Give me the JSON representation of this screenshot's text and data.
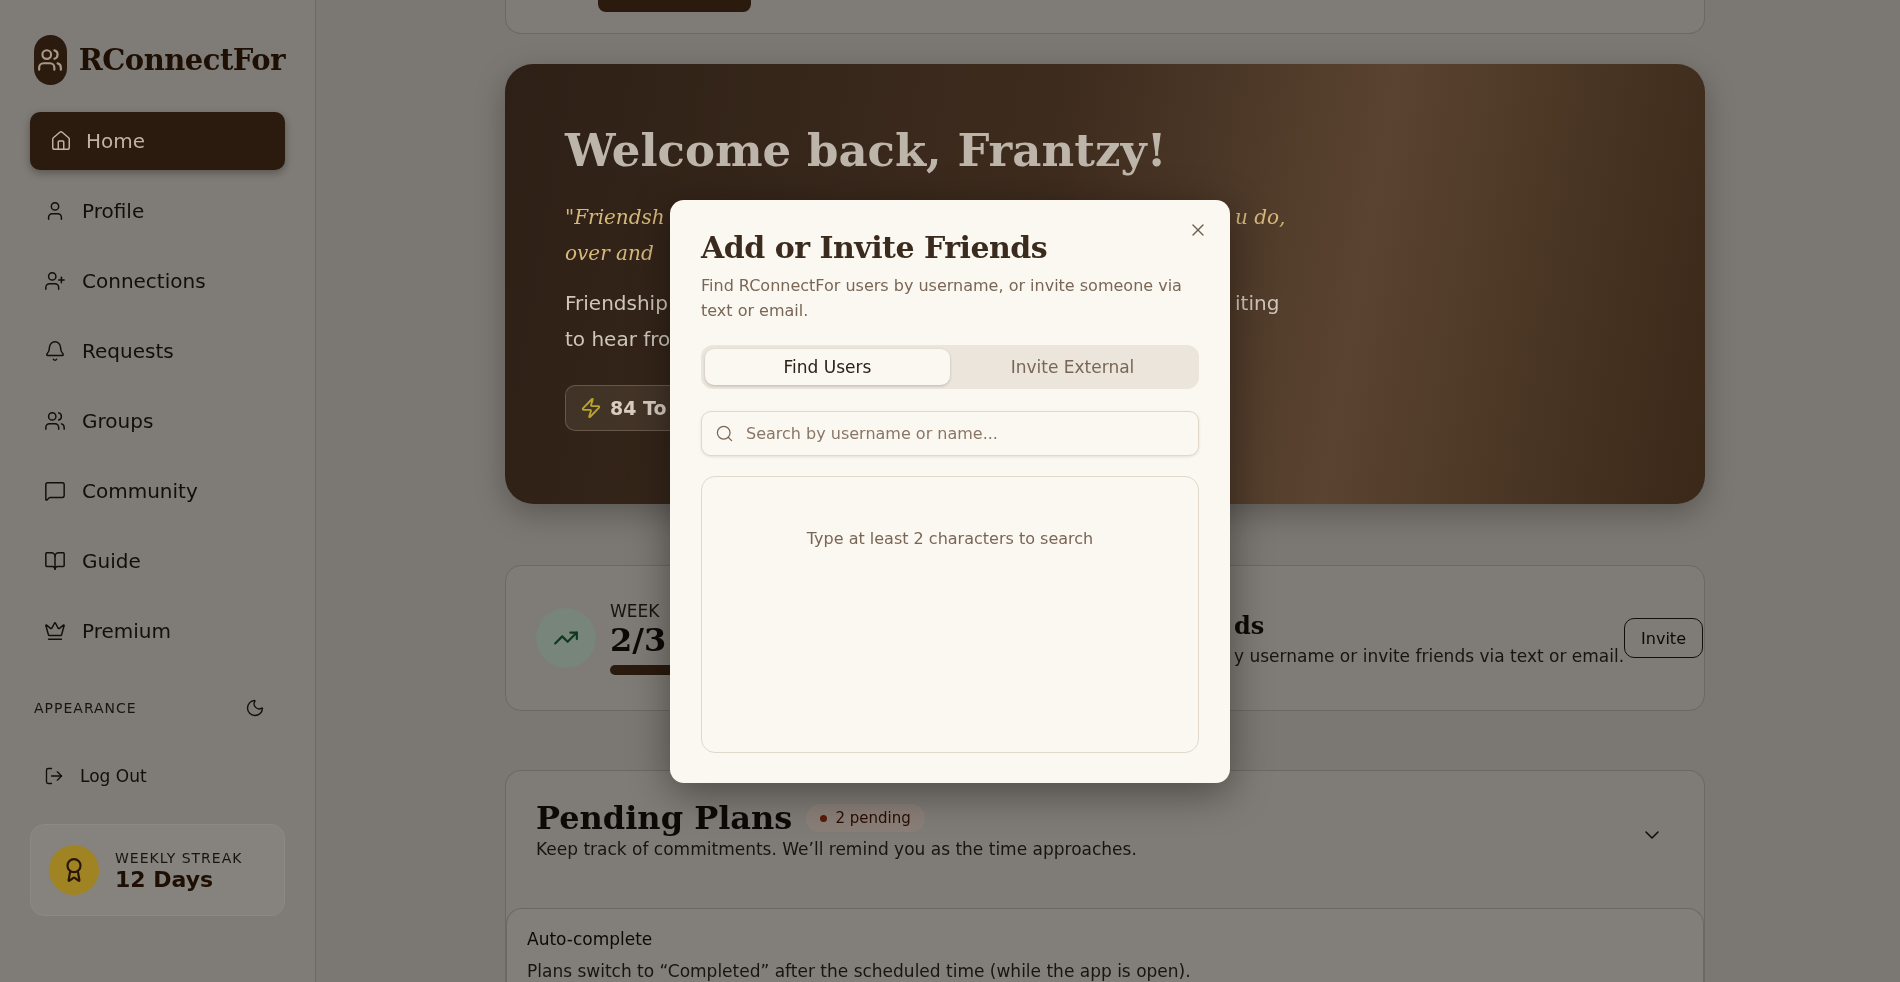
{
  "sidebar": {
    "brand": "RConnectFor",
    "items": [
      {
        "kind": "home",
        "label": "Home",
        "selected": true
      },
      {
        "kind": "user",
        "label": "Profile",
        "selected": false
      },
      {
        "kind": "user-plus",
        "label": "Connections",
        "selected": false
      },
      {
        "kind": "bell",
        "label": "Requests",
        "selected": false
      },
      {
        "kind": "users",
        "label": "Groups",
        "selected": false
      },
      {
        "kind": "chat",
        "label": "Community",
        "selected": false
      },
      {
        "kind": "book",
        "label": "Guide",
        "selected": false
      },
      {
        "kind": "crown",
        "label": "Premium",
        "selected": false
      }
    ],
    "appearance_label": "APPEARANCE",
    "logout": "Log Out",
    "streak": {
      "label": "WEEKLY STREAK",
      "value": "12 Days"
    }
  },
  "hero": {
    "title": "Welcome back, Frantzy!",
    "quote_left": [
      "\"Friendsh",
      "over and"
    ],
    "quote_right": [
      "u do,"
    ],
    "body_left": [
      "Friendship",
      "to hear fro"
    ],
    "body_right": [
      "iting"
    ],
    "badge": "84 To"
  },
  "stats": {
    "label": "WEEK",
    "value": "2/3",
    "level": 0.67,
    "title": "ds",
    "description": "y username or invite friends via text or email.",
    "button": "Invite"
  },
  "pending": {
    "title": "Pending Plans",
    "badge": "2 pending",
    "subtitle": "Keep track of commitments. We’ll remind you as the time approaches.",
    "expanded": false
  },
  "autocomplete": {
    "title": "Auto-complete",
    "description": "Plans switch to “Completed” after the scheduled time (while the app is open)."
  },
  "modal": {
    "title": "Add or Invite Friends",
    "description": "Find RConnectFor users by username, or invite someone via text or email.",
    "tabs": [
      {
        "label": "Find Users",
        "selected": true
      },
      {
        "label": "Invite External",
        "selected": false
      }
    ],
    "search": {
      "placeholder": "Search by username or name..."
    },
    "empty": "Type at least 2 characters to search"
  }
}
